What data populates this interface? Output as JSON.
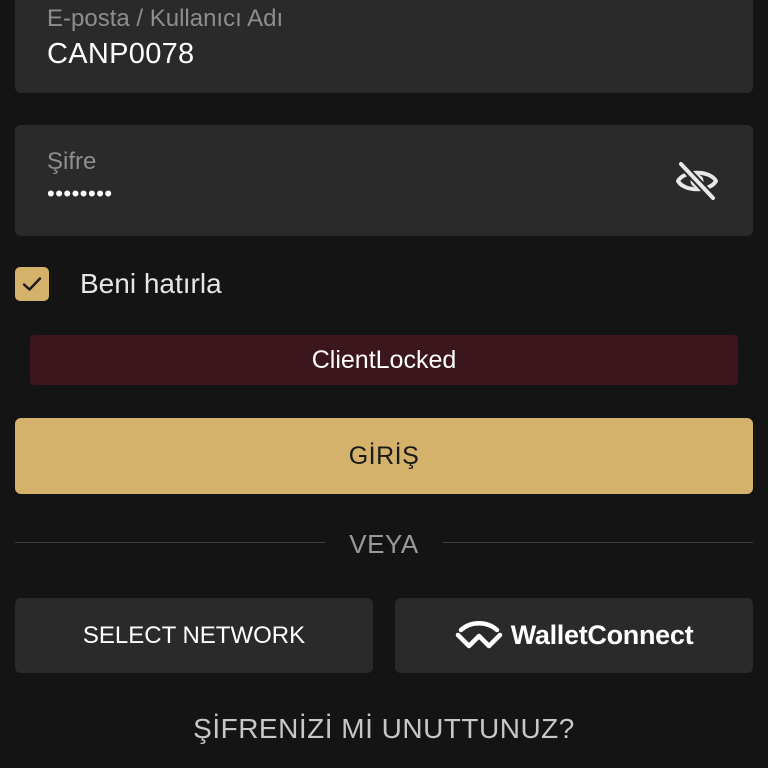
{
  "login_form": {
    "email_field": {
      "label": "E-posta / Kullanıcı Adı",
      "value": "CANP0078"
    },
    "password_field": {
      "label": "Şifre",
      "masked_value": "••••••••",
      "visibility_icon": "eye-off-icon"
    },
    "remember_me": {
      "label": "Beni hatırla",
      "checked": true
    },
    "error_message": "ClientLocked",
    "login_button_label": "GİRİŞ",
    "divider_label": "VEYA",
    "select_network_label": "SELECT NETWORK",
    "walletconnect": {
      "label": "WalletConnect",
      "icon": "walletconnect-logo-icon"
    },
    "forgot_password_label": "ŞİFRENİZİ Mİ UNUTTUNUZ?"
  },
  "colors": {
    "background": "#141414",
    "field_background": "#2a2a2a",
    "accent": "#d4b26c",
    "error_background": "#3c161d"
  }
}
